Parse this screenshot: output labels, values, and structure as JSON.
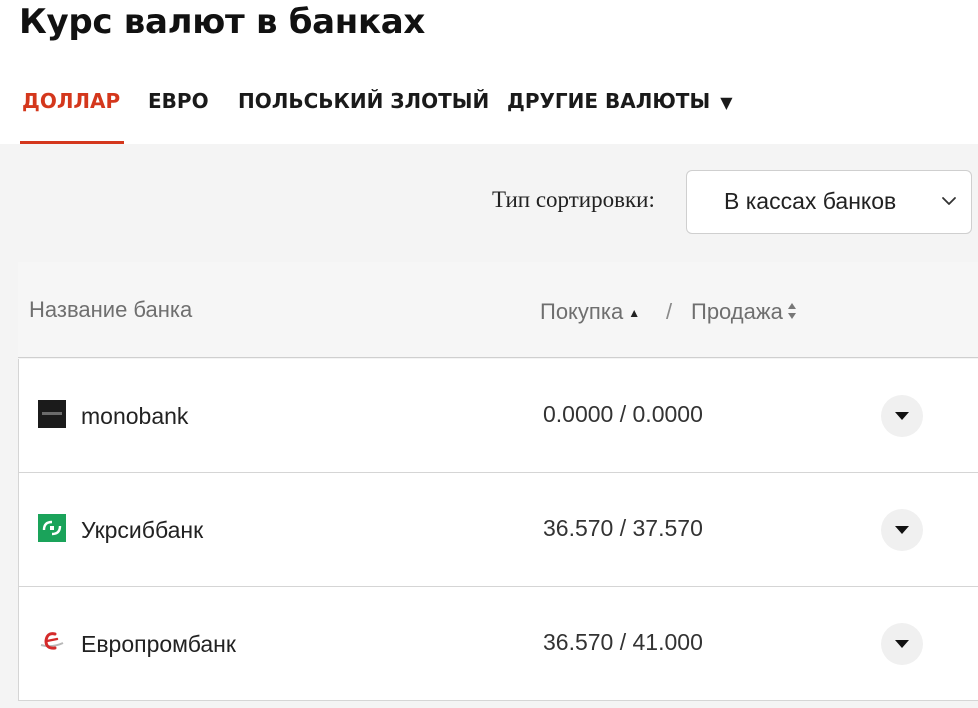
{
  "page": {
    "title": "Курс валют в банках"
  },
  "tabs": [
    {
      "label": "ДОЛЛАР",
      "active": true
    },
    {
      "label": "ЕВРО",
      "active": false
    },
    {
      "label": "ПОЛЬСЬКИЙ ЗЛОТЫЙ",
      "active": false
    },
    {
      "label": "ДРУГИЕ ВАЛЮТЫ",
      "active": false,
      "dropdown": true
    }
  ],
  "sort": {
    "label": "Тип сортировки:",
    "selected": "В кассах банков"
  },
  "table": {
    "headers": {
      "name": "Название банка",
      "buy": "Покупка",
      "separator": "/",
      "sell": "Продажа"
    },
    "rows": [
      {
        "bank": "monobank",
        "rate": "0.0000 / 0.0000",
        "logo_icon": "monobank-logo-icon"
      },
      {
        "bank": "Укрсиббанк",
        "rate": "36.570 / 37.570",
        "logo_icon": "ukrsibbank-logo-icon"
      },
      {
        "bank": "Европромбанк",
        "rate": "36.570 / 41.000",
        "logo_icon": "europrombank-logo-icon"
      }
    ]
  },
  "colors": {
    "accent": "#d4371c",
    "background": "#f4f4f4",
    "ukrsib_green": "#1aa35a"
  }
}
